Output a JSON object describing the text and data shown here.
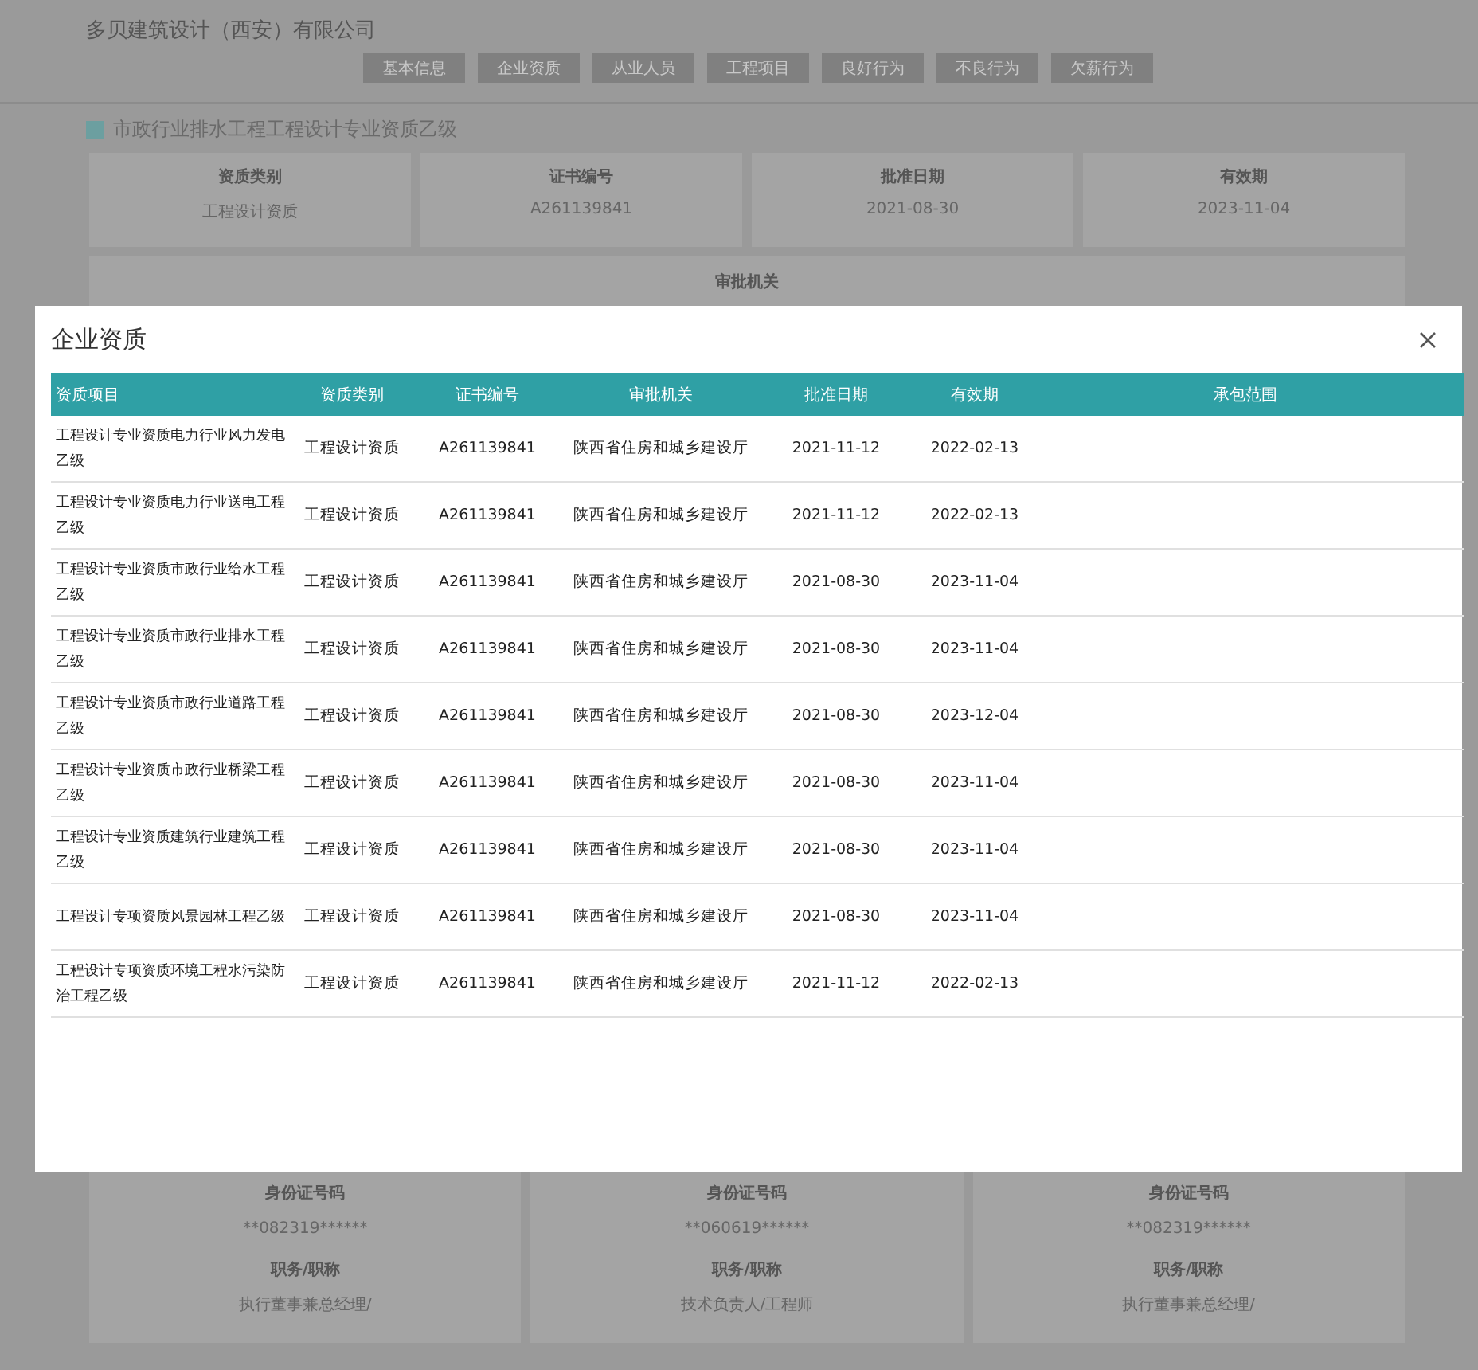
{
  "company_name": "多贝建筑设计（西安）有限公司",
  "nav_tabs": [
    {
      "label": "基本信息",
      "selected": false
    },
    {
      "label": "企业资质",
      "selected": false
    },
    {
      "label": "从业人员",
      "selected": false
    },
    {
      "label": "工程项目",
      "selected": false
    },
    {
      "label": "良好行为",
      "selected": false
    },
    {
      "label": "不良行为",
      "selected": false
    },
    {
      "label": "欠薪行为",
      "selected": false
    }
  ],
  "section_title": "市政行业排水工程工程设计专业资质乙级",
  "info_cards": [
    {
      "label": "资质类别",
      "value": "工程设计资质"
    },
    {
      "label": "证书编号",
      "value": "A261139841"
    },
    {
      "label": "批准日期",
      "value": "2021-08-30"
    },
    {
      "label": "有效期",
      "value": "2023-11-04"
    }
  ],
  "approval_card": {
    "label": "审批机关"
  },
  "person_cards": [
    {
      "id_label": "身份证号码",
      "id": "**082319******",
      "title_label": "职务/职称",
      "title": "执行董事兼总经理/"
    },
    {
      "id_label": "身份证号码",
      "id": "**060619******",
      "title_label": "职务/职称",
      "title": "技术负责人/工程师"
    },
    {
      "id_label": "身份证号码",
      "id": "**082319******",
      "title_label": "职务/职称",
      "title": "执行董事兼总经理/"
    }
  ],
  "modal": {
    "title": "企业资质",
    "columns": [
      "资质项目",
      "资质类别",
      "证书编号",
      "审批机关",
      "批准日期",
      "有效期",
      "承包范围"
    ],
    "rows": [
      [
        "工程设计专业资质电力行业风力发电乙级",
        "工程设计资质",
        "A261139841",
        "陕西省住房和城乡建设厅",
        "2021-11-12",
        "2022-02-13"
      ],
      [
        "工程设计专业资质电力行业送电工程乙级",
        "工程设计资质",
        "A261139841",
        "陕西省住房和城乡建设厅",
        "2021-11-12",
        "2022-02-13"
      ],
      [
        "工程设计专业资质市政行业给水工程乙级",
        "工程设计资质",
        "A261139841",
        "陕西省住房和城乡建设厅",
        "2021-08-30",
        "2023-11-04"
      ],
      [
        "工程设计专业资质市政行业排水工程乙级",
        "工程设计资质",
        "A261139841",
        "陕西省住房和城乡建设厅",
        "2021-08-30",
        "2023-11-04"
      ],
      [
        "工程设计专业资质市政行业道路工程乙级",
        "工程设计资质",
        "A261139841",
        "陕西省住房和城乡建设厅",
        "2021-08-30",
        "2023-12-04"
      ],
      [
        "工程设计专业资质市政行业桥梁工程乙级",
        "工程设计资质",
        "A261139841",
        "陕西省住房和城乡建设厅",
        "2021-08-30",
        "2023-11-04"
      ],
      [
        "工程设计专业资质建筑行业建筑工程乙级",
        "工程设计资质",
        "A261139841",
        "陕西省住房和城乡建设厅",
        "2021-08-30",
        "2023-11-04"
      ],
      [
        "工程设计专项资质风景园林工程乙级",
        "工程设计资质",
        "A261139841",
        "陕西省住房和城乡建设厅",
        "2021-08-30",
        "2023-11-04"
      ],
      [
        "工程设计专项资质环境工程水污染防治工程乙级",
        "工程设计资质",
        "A261139841",
        "陕西省住房和城乡建设厅",
        "2021-11-12",
        "2022-02-13"
      ]
    ]
  }
}
